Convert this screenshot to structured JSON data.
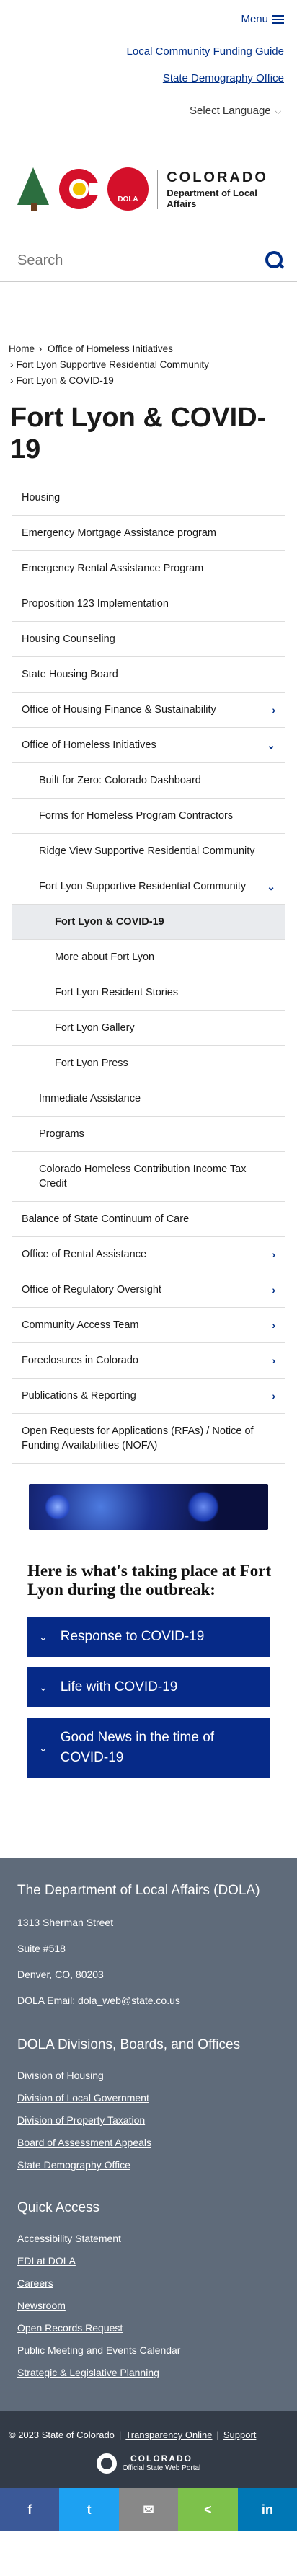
{
  "header": {
    "menu_label": "Menu",
    "links": [
      "Local Community Funding Guide",
      "State Demography Office"
    ],
    "language_label": "Select Language",
    "logo": {
      "title": "COLORADO",
      "subtitle": "Department of Local Affairs",
      "badge": "DOLA"
    },
    "search_placeholder": "Search"
  },
  "breadcrumb": {
    "home": "Home",
    "sep": "›",
    "level1": "Office of Homeless Initiatives",
    "level2": "Fort Lyon Supportive Residential Community",
    "current": "Fort Lyon & COVID-19"
  },
  "page_title": "Fort Lyon & COVID-19",
  "sidenav": {
    "items": [
      {
        "label": "Housing",
        "level": 0,
        "caret": ""
      },
      {
        "label": "Emergency Mortgage Assistance program",
        "level": 0,
        "caret": ""
      },
      {
        "label": "Emergency Rental Assistance Program",
        "level": 0,
        "caret": ""
      },
      {
        "label": "Proposition 123 Implementation",
        "level": 0,
        "caret": ""
      },
      {
        "label": "Housing Counseling",
        "level": 0,
        "caret": ""
      },
      {
        "label": "State Housing Board",
        "level": 0,
        "caret": ""
      },
      {
        "label": "Office of Housing Finance & Sustainability",
        "level": 0,
        "caret": "›"
      },
      {
        "label": "Office of Homeless Initiatives",
        "level": 0,
        "caret": "⌄"
      },
      {
        "label": "Built for Zero: Colorado Dashboard",
        "level": 1,
        "caret": ""
      },
      {
        "label": "Forms for Homeless Program Contractors",
        "level": 1,
        "caret": ""
      },
      {
        "label": "Ridge View Supportive Residential Community",
        "level": 1,
        "caret": ""
      },
      {
        "label": "Fort Lyon Supportive Residential Community",
        "level": 1,
        "caret": "⌄"
      },
      {
        "label": "Fort Lyon & COVID-19",
        "level": 2,
        "caret": "",
        "active": true
      },
      {
        "label": "More about Fort Lyon",
        "level": 2,
        "caret": ""
      },
      {
        "label": "Fort Lyon Resident Stories",
        "level": 2,
        "caret": ""
      },
      {
        "label": "Fort Lyon Gallery",
        "level": 2,
        "caret": ""
      },
      {
        "label": "Fort Lyon Press",
        "level": 2,
        "caret": ""
      },
      {
        "label": "Immediate Assistance",
        "level": 1,
        "caret": ""
      },
      {
        "label": "Programs",
        "level": 1,
        "caret": ""
      },
      {
        "label": "Colorado Homeless Contribution Income Tax Credit",
        "level": 1,
        "caret": ""
      },
      {
        "label": "Balance of State Continuum of Care",
        "level": 0,
        "caret": ""
      },
      {
        "label": "Office of Rental Assistance",
        "level": 0,
        "caret": "›"
      },
      {
        "label": "Office of Regulatory Oversight",
        "level": 0,
        "caret": "›"
      },
      {
        "label": "Community Access Team",
        "level": 0,
        "caret": "›"
      },
      {
        "label": "Foreclosures in Colorado",
        "level": 0,
        "caret": "›"
      },
      {
        "label": "Publications & Reporting",
        "level": 0,
        "caret": "›"
      },
      {
        "label": "Open Requests for Applications (RFAs) / Notice of Funding Availabilities (NOFA)",
        "level": 0,
        "caret": ""
      }
    ]
  },
  "main": {
    "heading": "Here is what's taking place at Fort Lyon during the outbreak:",
    "accordions": [
      "Response to COVID-19",
      "Life with COVID-19",
      "Good News in the time of COVID-19"
    ],
    "accordion_chevron": "⌄"
  },
  "footer": {
    "dola_title": "The Department of Local Affairs (DOLA)",
    "address1": "1313 Sherman Street",
    "address2": "Suite  #518",
    "address3": "Denver, CO, 80203",
    "email_label": "DOLA Email:",
    "email": "dola_web@state.co.us",
    "divisions_title": "DOLA Divisions, Boards, and Offices",
    "divisions": [
      "Division of Housing",
      "Division of Local Government",
      "Division of Property Taxation",
      "Board of Assessment Appeals",
      "State Demography Office"
    ],
    "quick_title": "Quick Access",
    "quick": [
      "Accessibility Statement",
      "EDI at DOLA",
      "Careers",
      "Newsroom",
      "Open Records Request",
      "Public Meeting and Events Calendar",
      "Strategic & Legislative Planning"
    ]
  },
  "subfooter": {
    "copyright": "© 2023 State of Colorado",
    "links": [
      "Transparency Online",
      "Support"
    ],
    "sep": "|",
    "logo_title": "COLORADO",
    "logo_subtitle": "Official State Web Portal"
  },
  "share": [
    {
      "label": "f",
      "color": "#3b5998",
      "name": "facebook-icon"
    },
    {
      "label": "t",
      "color": "#1da1f2",
      "name": "twitter-icon"
    },
    {
      "label": "✉",
      "color": "#888888",
      "name": "email-icon"
    },
    {
      "label": "<",
      "color": "#7dc14b",
      "name": "share-icon"
    },
    {
      "label": "in",
      "color": "#0077b5",
      "name": "linkedin-icon"
    }
  ]
}
